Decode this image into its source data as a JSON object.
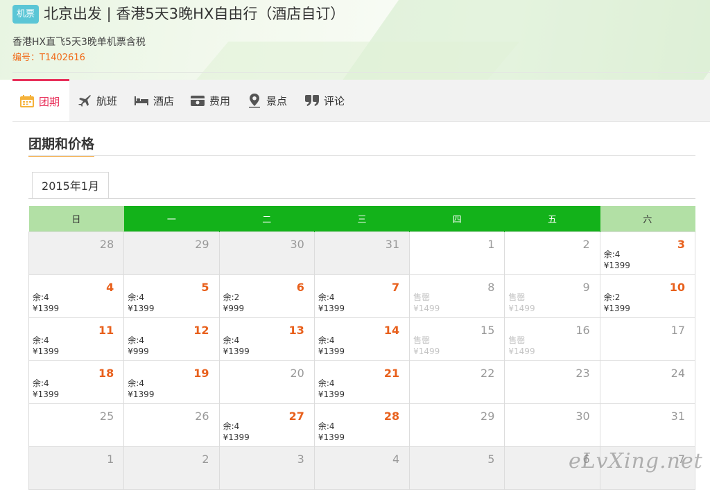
{
  "header": {
    "badge": "机票",
    "title": "北京出发 | 香港5天3晚HX自由行（酒店自订）",
    "subtitle": "香港HX直飞5天3晚单机票含税",
    "code_label": "编号：",
    "code_value": "T1402616"
  },
  "tabs": [
    {
      "label": "团期",
      "icon": "calendar-icon",
      "active": true
    },
    {
      "label": "航班",
      "icon": "plane-icon",
      "active": false
    },
    {
      "label": "酒店",
      "icon": "bed-icon",
      "active": false
    },
    {
      "label": "费用",
      "icon": "wallet-icon",
      "active": false
    },
    {
      "label": "景点",
      "icon": "location-pin-icon",
      "active": false
    },
    {
      "label": "评论",
      "icon": "quote-icon",
      "active": false
    }
  ],
  "section": {
    "title": "团期和价格",
    "month_tab": "2015年1月"
  },
  "calendar": {
    "weekdays": [
      "日",
      "一",
      "二",
      "三",
      "四",
      "五",
      "六"
    ],
    "weeks": [
      [
        {
          "day": "28",
          "off": true
        },
        {
          "day": "29",
          "off": true
        },
        {
          "day": "30",
          "off": true
        },
        {
          "day": "31",
          "off": true
        },
        {
          "day": "1"
        },
        {
          "day": "2"
        },
        {
          "day": "3",
          "hot": true,
          "remain": "余:4",
          "price": "¥1399"
        }
      ],
      [
        {
          "day": "4",
          "hot": true,
          "remain": "余:4",
          "price": "¥1399"
        },
        {
          "day": "5",
          "hot": true,
          "remain": "余:4",
          "price": "¥1399"
        },
        {
          "day": "6",
          "hot": true,
          "remain": "余:2",
          "price": "¥999"
        },
        {
          "day": "7",
          "hot": true,
          "remain": "余:4",
          "price": "¥1399"
        },
        {
          "day": "8",
          "sold": true,
          "remain": "售罄",
          "price": "¥1499"
        },
        {
          "day": "9",
          "sold": true,
          "remain": "售罄",
          "price": "¥1499"
        },
        {
          "day": "10",
          "hot": true,
          "remain": "余:2",
          "price": "¥1399"
        }
      ],
      [
        {
          "day": "11",
          "hot": true,
          "remain": "余:4",
          "price": "¥1399"
        },
        {
          "day": "12",
          "hot": true,
          "remain": "余:4",
          "price": "¥999"
        },
        {
          "day": "13",
          "hot": true,
          "remain": "余:4",
          "price": "¥1399"
        },
        {
          "day": "14",
          "hot": true,
          "remain": "余:4",
          "price": "¥1399"
        },
        {
          "day": "15",
          "sold": true,
          "remain": "售罄",
          "price": "¥1499"
        },
        {
          "day": "16",
          "sold": true,
          "remain": "售罄",
          "price": "¥1499"
        },
        {
          "day": "17"
        }
      ],
      [
        {
          "day": "18",
          "hot": true,
          "remain": "余:4",
          "price": "¥1399"
        },
        {
          "day": "19",
          "hot": true,
          "remain": "余:4",
          "price": "¥1399"
        },
        {
          "day": "20"
        },
        {
          "day": "21",
          "hot": true,
          "remain": "余:4",
          "price": "¥1399"
        },
        {
          "day": "22"
        },
        {
          "day": "23"
        },
        {
          "day": "24"
        }
      ],
      [
        {
          "day": "25"
        },
        {
          "day": "26"
        },
        {
          "day": "27",
          "hot": true,
          "remain": "余:4",
          "price": "¥1399"
        },
        {
          "day": "28",
          "hot": true,
          "remain": "余:4",
          "price": "¥1399"
        },
        {
          "day": "29"
        },
        {
          "day": "30"
        },
        {
          "day": "31"
        }
      ],
      [
        {
          "day": "1",
          "off": true
        },
        {
          "day": "2",
          "off": true
        },
        {
          "day": "3",
          "off": true
        },
        {
          "day": "4",
          "off": true
        },
        {
          "day": "5",
          "off": true
        },
        {
          "day": "6",
          "off": true
        },
        {
          "day": "7",
          "off": true
        }
      ]
    ]
  },
  "watermark": "eLvXing.net",
  "colors": {
    "accent_red": "#e8305a",
    "price_orange": "#e8601c",
    "weekday_green": "#13b21a",
    "weekend_green": "#b2e0a5",
    "badge_teal": "#5bc6d6"
  }
}
